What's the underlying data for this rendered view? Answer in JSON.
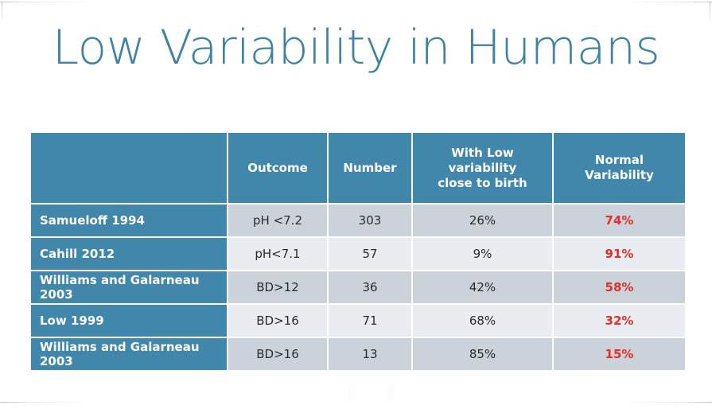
{
  "slide": {
    "title": "Low Variability in Humans",
    "title_color": "#3f82a4",
    "background": "#ffffff"
  },
  "theme": {
    "header_fill": "#4087ab",
    "row_band_dark": "#ccd2da",
    "row_band_light": "#e9ecf1",
    "accent_red": "#e03028",
    "header_text": "#ffffff",
    "body_text": "#2b2b2b"
  },
  "table": {
    "columns": [
      {
        "key": "study",
        "label": ""
      },
      {
        "key": "outcome",
        "label": "Outcome"
      },
      {
        "key": "number",
        "label": "Number"
      },
      {
        "key": "low_variability",
        "label": "With Low variability close to birth"
      },
      {
        "key": "normal_variability",
        "label": "Normal Variability"
      }
    ],
    "header": {
      "blank": "",
      "outcome": "Outcome",
      "number": "Number",
      "low_variability_line1": "With Low variability",
      "low_variability_line2": "close to birth",
      "normal_variability": "Normal Variability"
    },
    "rows": [
      {
        "study": "Samueloff  1994",
        "outcome": "pH <7.2",
        "number": "303",
        "low_variability": "26%",
        "normal_variability": "74%"
      },
      {
        "study": "Cahill 2012",
        "outcome": "pH<7.1",
        "number": "57",
        "low_variability": "9%",
        "normal_variability": "91%"
      },
      {
        "study": "Williams and Galarneau 2003",
        "outcome": "BD>12",
        "number": "36",
        "low_variability": "42%",
        "normal_variability": "58%"
      },
      {
        "study": "Low 1999",
        "outcome": "BD>16",
        "number": "71",
        "low_variability": "68%",
        "normal_variability": "32%"
      },
      {
        "study": "Williams and Galarneau 2003",
        "outcome": "BD>16",
        "number": "13",
        "low_variability": "85%",
        "normal_variability": "15%"
      }
    ]
  }
}
